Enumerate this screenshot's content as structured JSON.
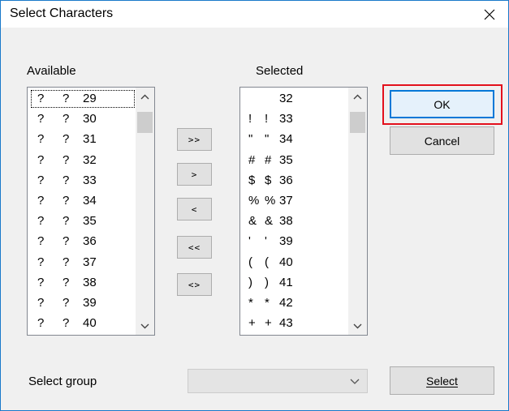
{
  "window": {
    "title": "Select Characters"
  },
  "available": {
    "label": "Available",
    "items": [
      {
        "a": "?",
        "b": "?",
        "code": "29"
      },
      {
        "a": "?",
        "b": "?",
        "code": "30"
      },
      {
        "a": "?",
        "b": "?",
        "code": "31"
      },
      {
        "a": "?",
        "b": "?",
        "code": "32"
      },
      {
        "a": "?",
        "b": "?",
        "code": "33"
      },
      {
        "a": "?",
        "b": "?",
        "code": "34"
      },
      {
        "a": "?",
        "b": "?",
        "code": "35"
      },
      {
        "a": "?",
        "b": "?",
        "code": "36"
      },
      {
        "a": "?",
        "b": "?",
        "code": "37"
      },
      {
        "a": "?",
        "b": "?",
        "code": "38"
      },
      {
        "a": "?",
        "b": "?",
        "code": "39"
      },
      {
        "a": "?",
        "b": "?",
        "code": "40"
      }
    ]
  },
  "selected": {
    "label": "Selected",
    "items": [
      {
        "a": "",
        "b": "",
        "code": "32"
      },
      {
        "a": "!",
        "b": "!",
        "code": "33"
      },
      {
        "a": "\"",
        "b": "\"",
        "code": "34"
      },
      {
        "a": "#",
        "b": "#",
        "code": "35"
      },
      {
        "a": "$",
        "b": "$",
        "code": "36"
      },
      {
        "a": "%",
        "b": "%",
        "code": "37"
      },
      {
        "a": "&",
        "b": "&",
        "code": "38"
      },
      {
        "a": "'",
        "b": "'",
        "code": "39"
      },
      {
        "a": "(",
        "b": "(",
        "code": "40"
      },
      {
        "a": ")",
        "b": ")",
        "code": "41"
      },
      {
        "a": "*",
        "b": "*",
        "code": "42"
      },
      {
        "a": "+",
        "b": "+",
        "code": "43"
      }
    ]
  },
  "move_buttons": {
    "add_all": ">>",
    "add": ">",
    "remove": "<",
    "remove_all": "<<",
    "swap": "<>"
  },
  "buttons": {
    "ok": "OK",
    "cancel": "Cancel",
    "select": "Select"
  },
  "footer": {
    "group_label": "Select group",
    "group_value": ""
  },
  "icons": {
    "close": "close-icon",
    "scroll_up": "chevron-up-icon",
    "scroll_down": "chevron-down-icon",
    "combo_arrow": "chevron-down-icon"
  },
  "colors": {
    "highlight": "#e3101c",
    "default_button_border": "#0078d7",
    "window_border": "#1979ca"
  }
}
